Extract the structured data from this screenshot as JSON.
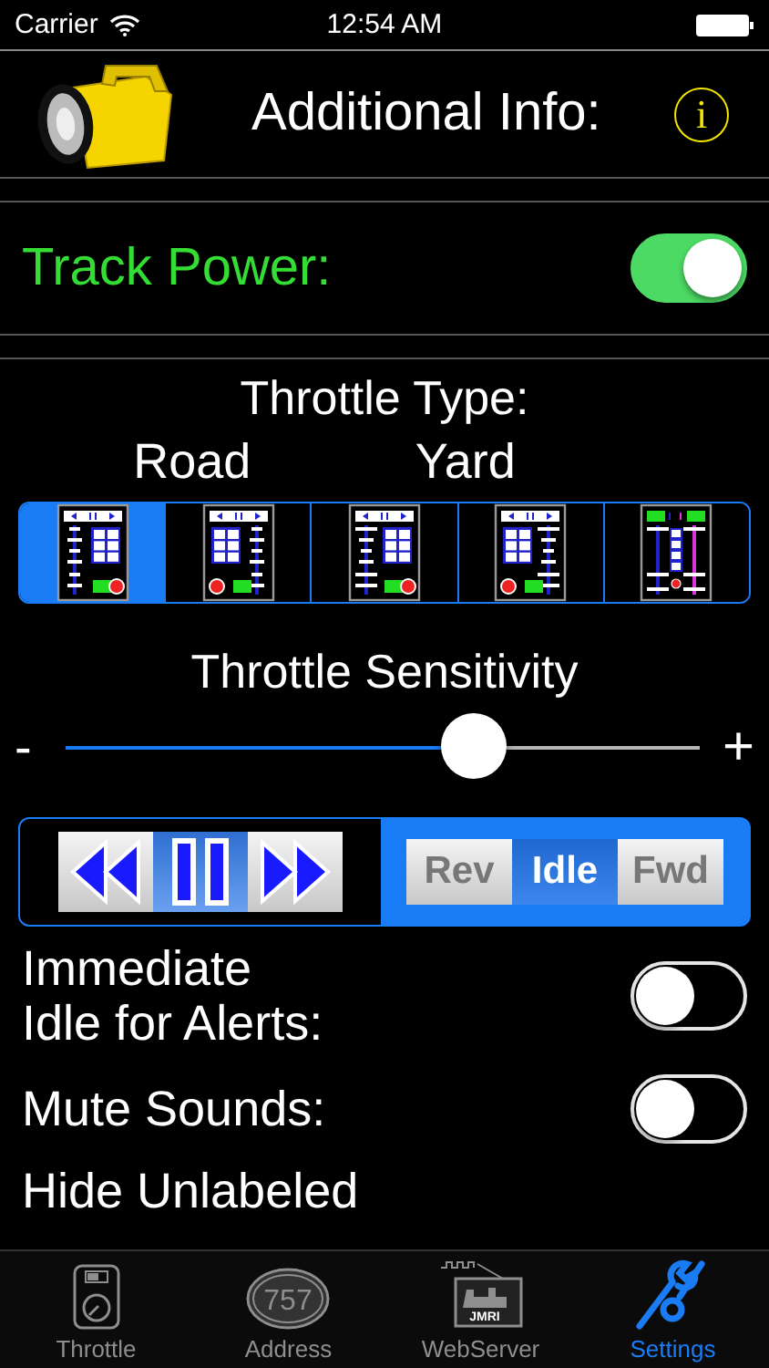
{
  "status_bar": {
    "carrier": "Carrier",
    "time": "12:54 AM"
  },
  "header": {
    "title": "Additional Info:",
    "info_button": "i"
  },
  "track_power": {
    "label": "Track Power:",
    "on": true
  },
  "throttle_type": {
    "title": "Throttle Type:",
    "groups": [
      "Road",
      "Yard"
    ],
    "options": [
      {
        "kind": "grid-right",
        "selected": true
      },
      {
        "kind": "grid-left",
        "selected": false
      },
      {
        "kind": "grid-right-bars",
        "selected": false
      },
      {
        "kind": "grid-left-bars",
        "selected": false
      },
      {
        "kind": "dual",
        "selected": false
      }
    ]
  },
  "sensitivity": {
    "title": "Throttle Sensitivity",
    "min_label": "-",
    "max_label": "+",
    "level": 0.645
  },
  "motion": {
    "buttons": [
      {
        "kind": "rewind",
        "selected": false
      },
      {
        "kind": "pause",
        "selected": true
      },
      {
        "kind": "forward",
        "selected": false
      }
    ],
    "direction": [
      {
        "label": "Rev",
        "selected": false
      },
      {
        "label": "Idle",
        "selected": true
      },
      {
        "label": "Fwd",
        "selected": false
      }
    ]
  },
  "settings": [
    {
      "label": "Immediate\nIdle for Alerts:",
      "on": false
    },
    {
      "label": "Mute Sounds:",
      "on": false
    }
  ],
  "partial_setting": {
    "label": "Hide Unlabeled"
  },
  "tab_bar": [
    {
      "label": "Throttle",
      "kind": "throttle",
      "selected": false
    },
    {
      "label": "Address",
      "kind": "address",
      "badge": "757",
      "selected": false
    },
    {
      "label": "WebServer",
      "kind": "webserver",
      "badge": "JMRI",
      "selected": false
    },
    {
      "label": "Settings",
      "kind": "settings",
      "selected": true
    }
  ]
}
